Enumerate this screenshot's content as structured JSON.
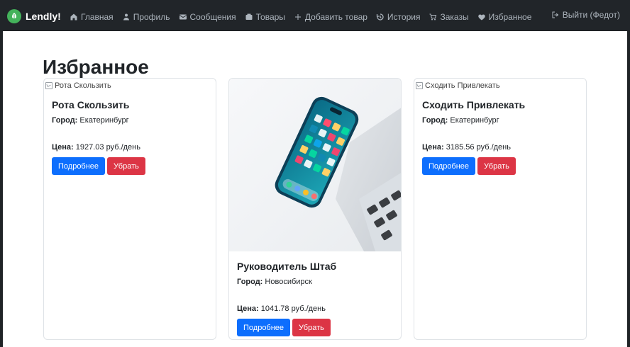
{
  "brand": {
    "name": "Lendly!"
  },
  "nav": {
    "items": [
      {
        "label": "Главная",
        "icon": "home-icon"
      },
      {
        "label": "Профиль",
        "icon": "user-icon"
      },
      {
        "label": "Сообщения",
        "icon": "mail-icon"
      },
      {
        "label": "Товары",
        "icon": "box-icon"
      },
      {
        "label": "Добавить товар",
        "icon": "plus-icon"
      },
      {
        "label": "История",
        "icon": "history-icon"
      },
      {
        "label": "Заказы",
        "icon": "cart-icon"
      },
      {
        "label": "Избранное",
        "icon": "heart-icon"
      }
    ],
    "logout": "Выйти (Федот)"
  },
  "page": {
    "title": "Избранное"
  },
  "cards": [
    {
      "image_alt": "Рота Скользить",
      "title": "Рота Скользить",
      "city_label": "Город:",
      "city": "Екатеринбург",
      "price_label": "Цена:",
      "price": "1927.03 руб./день",
      "details_btn": "Подробнее",
      "remove_btn": "Убрать"
    },
    {
      "image_alt": "",
      "title": "Руководитель Штаб",
      "city_label": "Город:",
      "city": "Новосибирск",
      "price_label": "Цена:",
      "price": "1041.78 руб./день",
      "details_btn": "Подробнее",
      "remove_btn": "Убрать"
    },
    {
      "image_alt": "Сходить Привлекать",
      "title": "Сходить Привлекать",
      "city_label": "Город:",
      "city": "Екатеринбург",
      "price_label": "Цена:",
      "price": "3185.56 руб./день",
      "details_btn": "Подробнее",
      "remove_btn": "Убрать"
    }
  ],
  "colors": {
    "navbar": "#212529",
    "primary": "#0d6efd",
    "danger": "#dc3545",
    "brand_green": "#44b35b"
  }
}
